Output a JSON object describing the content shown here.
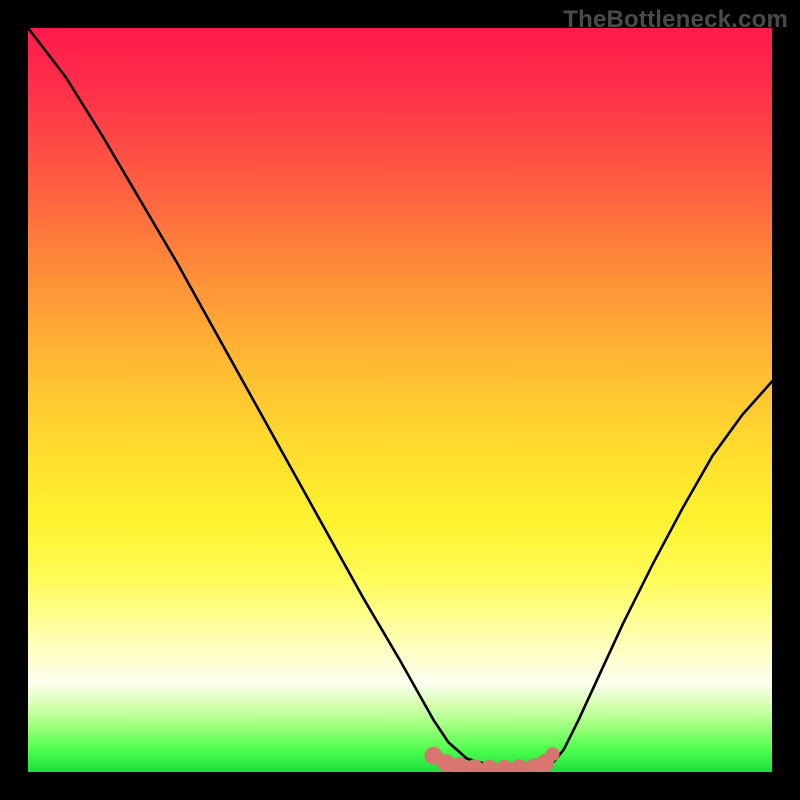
{
  "watermark": "TheBottleneck.com",
  "colors": {
    "page_bg": "#000000",
    "watermark_text": "#4a4a4a",
    "curve": "#000000",
    "marker_fill": "#d6766e",
    "marker_stroke": "#c15e56",
    "gradient_stops": [
      "#ff1a4b",
      "#ff5a42",
      "#ffb633",
      "#fff22e",
      "#ffffb0",
      "#9bff7a",
      "#1adf3c"
    ]
  },
  "chart_data": {
    "type": "line",
    "title": "",
    "xlabel": "",
    "ylabel": "",
    "x": [
      0.0,
      0.05,
      0.1,
      0.15,
      0.2,
      0.25,
      0.3,
      0.35,
      0.4,
      0.45,
      0.5,
      0.545,
      0.565,
      0.59,
      0.635,
      0.695,
      0.705,
      0.72,
      0.74,
      0.77,
      0.8,
      0.84,
      0.88,
      0.92,
      0.96,
      1.0
    ],
    "y": [
      1.0,
      0.935,
      0.855,
      0.77,
      0.685,
      0.595,
      0.505,
      0.415,
      0.325,
      0.235,
      0.15,
      0.07,
      0.04,
      0.018,
      0.005,
      0.005,
      0.012,
      0.03,
      0.07,
      0.135,
      0.2,
      0.28,
      0.355,
      0.425,
      0.48,
      0.525
    ],
    "xlim": [
      0,
      1
    ],
    "ylim": [
      0,
      1
    ],
    "series": [
      {
        "name": "bottleneck-curve",
        "x_ref": "x",
        "y_ref": "y"
      }
    ],
    "markers": {
      "name": "trough-band",
      "points": [
        {
          "x": 0.545,
          "y": 0.022
        },
        {
          "x": 0.562,
          "y": 0.012
        },
        {
          "x": 0.58,
          "y": 0.008
        },
        {
          "x": 0.6,
          "y": 0.005
        },
        {
          "x": 0.62,
          "y": 0.004
        },
        {
          "x": 0.64,
          "y": 0.004
        },
        {
          "x": 0.66,
          "y": 0.005
        },
        {
          "x": 0.68,
          "y": 0.006
        },
        {
          "x": 0.695,
          "y": 0.012
        }
      ],
      "endpoint": {
        "x": 0.705,
        "y": 0.024
      }
    },
    "annotations": []
  }
}
